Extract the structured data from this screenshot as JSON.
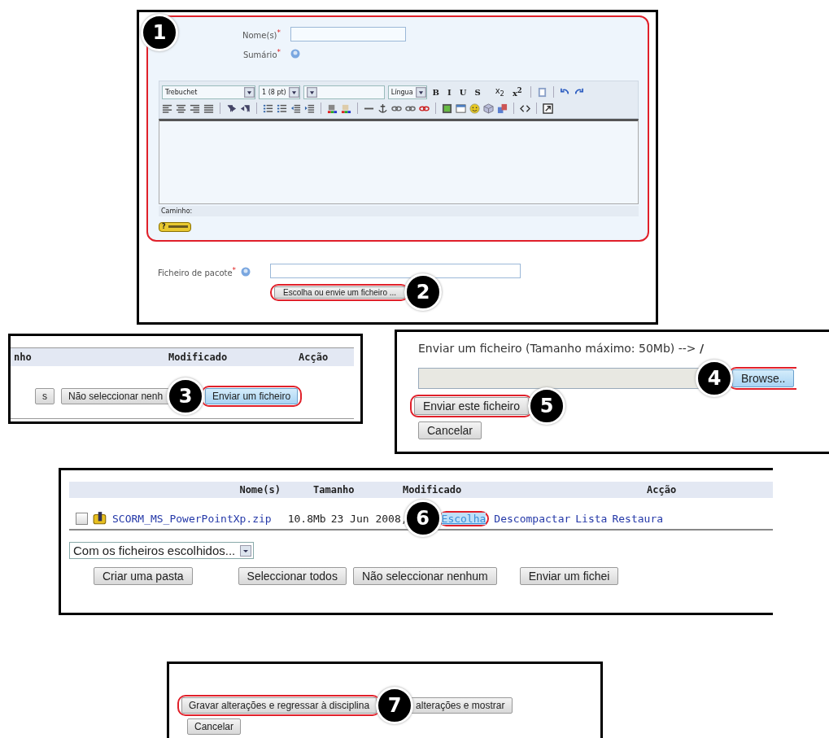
{
  "form_panel": {
    "step": "1",
    "fields": [
      {
        "label": "Nome(s)",
        "mark": "*",
        "kind": "input"
      },
      {
        "label": "Sumário",
        "mark": "*",
        "kind": "help"
      }
    ],
    "editor": {
      "selects": [
        {
          "value": "Trebuchet"
        },
        {
          "value": "1 (8 pt)"
        },
        {
          "blank": true
        },
        {
          "value": "Língua"
        }
      ],
      "format_buttons": [
        "B",
        "I",
        "U",
        "S",
        "x$_{2}$",
        "x$^{2}$"
      ],
      "path_label": "Caminho:",
      "help_badge": "?"
    },
    "package": {
      "label": "Ficheiro de pacote",
      "mark": "*",
      "button": "Escolha ou envie um ficheiro ...",
      "step": "2"
    }
  },
  "files_fragment": {
    "columns": [
      "nho",
      "Modificado",
      "Acção"
    ],
    "buttons": [
      {
        "label": "s",
        "highlighted": false
      },
      {
        "label": "Não seleccionar nenh",
        "highlighted": false
      },
      {
        "label": "Enviar um ficheiro",
        "highlighted": true
      }
    ],
    "step": "3"
  },
  "upload_panel": {
    "title": "Enviar um ficheiro (Tamanho máximo: 50Mb) --> **/**",
    "browse_button": "Browse..",
    "browse_step": "4",
    "submit_button": "Enviar este ficheiro",
    "submit_step": "5",
    "cancel_button": "Cancelar"
  },
  "file_list": {
    "columns": [
      "Nome(s)",
      "Tamanho",
      "Modificado",
      "Acção"
    ],
    "rows": [
      {
        "checked": false,
        "name": "SCORM_MS_PowerPointXp.zip",
        "size": "10.8Mb",
        "modified": "23 Jun 2008,",
        "step": "6",
        "actions": [
          {
            "label": "Escolha",
            "highlighted": true
          },
          {
            "label": "Descompactar",
            "highlighted": false
          },
          {
            "label": "Lista",
            "highlighted": false
          },
          {
            "label": "Restaura",
            "highlighted": false
          }
        ]
      }
    ],
    "bulk_select": "Com os ficheiros escolhidos...",
    "buttons": [
      "Criar uma pasta",
      "Seleccionar todos",
      "Não seleccionar nenhum",
      "Enviar um fichei"
    ]
  },
  "save_panel": {
    "buttons": [
      {
        "label": "Gravar alterações e regressar à disciplina",
        "highlighted": true
      },
      {
        "label": "alterações e mostrar",
        "highlighted": false
      }
    ],
    "step": "7",
    "cancel_button": "Cancelar"
  }
}
